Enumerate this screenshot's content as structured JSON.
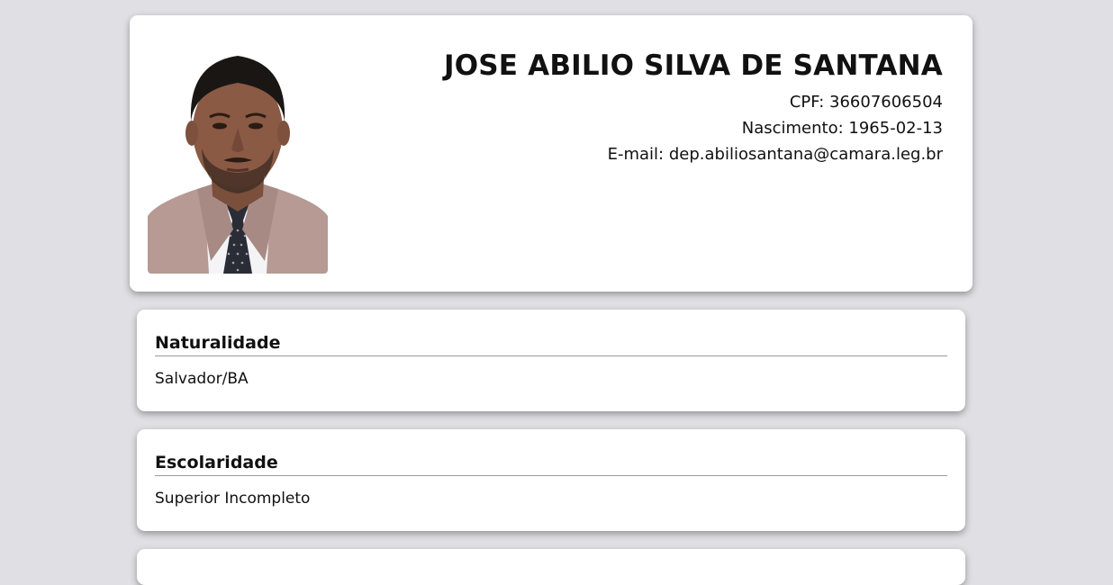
{
  "profile": {
    "name": "JOSE ABILIO SILVA DE SANTANA",
    "cpf_label": "CPF:",
    "cpf": "36607606504",
    "birth_label": "Nascimento:",
    "birth": "1965-02-13",
    "email_label": "E-mail:",
    "email": "dep.abiliosantana@camara.leg.br"
  },
  "cards": [
    {
      "title": "Naturalidade",
      "value": "Salvador/BA"
    },
    {
      "title": "Escolaridade",
      "value": "Superior Incompleto"
    }
  ]
}
